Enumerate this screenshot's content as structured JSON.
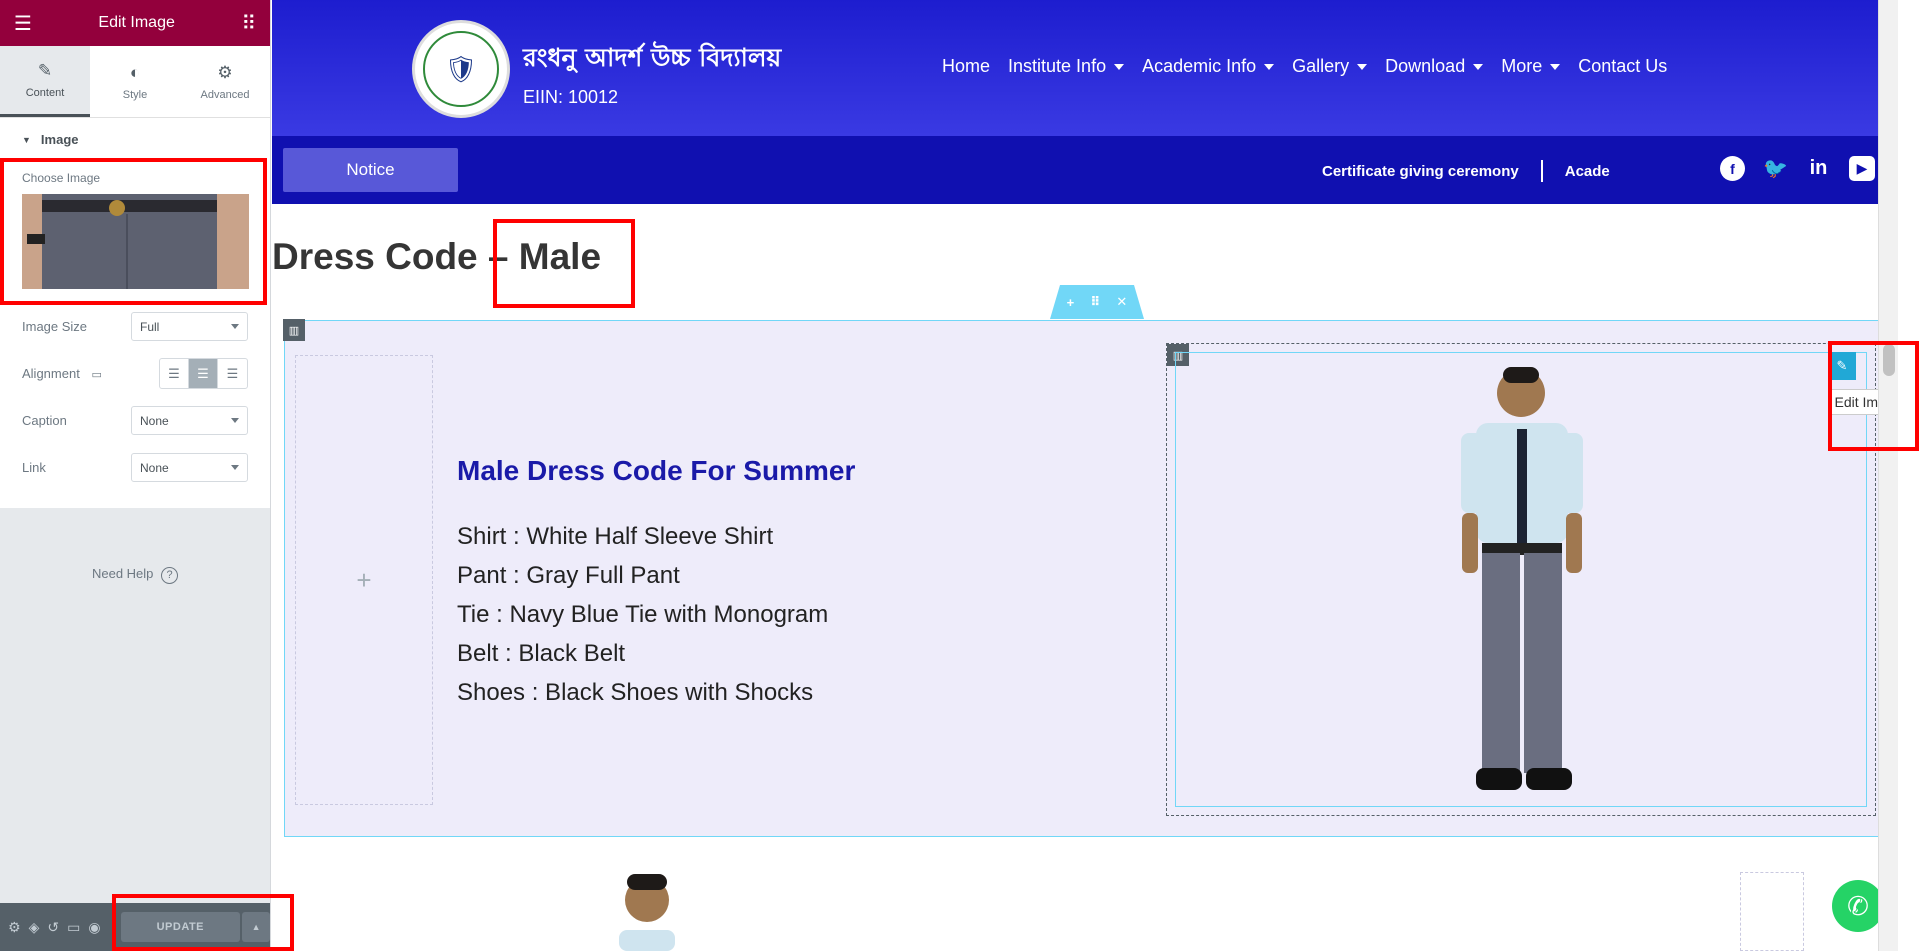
{
  "panel": {
    "title": "Edit Image",
    "tabs": [
      {
        "label": "Content",
        "icon": "pencil-icon"
      },
      {
        "label": "Style",
        "icon": "contrast-icon"
      },
      {
        "label": "Advanced",
        "icon": "gear-icon"
      }
    ],
    "section_title": "Image",
    "choose_image_label": "Choose Image",
    "image_size_label": "Image Size",
    "image_size_value": "Full",
    "alignment_label": "Alignment",
    "caption_label": "Caption",
    "caption_value": "None",
    "link_label": "Link",
    "link_value": "None",
    "need_help": "Need Help",
    "update_label": "UPDATE"
  },
  "site": {
    "school_name": "রংধনু আদর্শ উচ্চ বিদ্যালয়",
    "eiin": "EIIN: 10012",
    "nav": [
      {
        "label": "Home",
        "dropdown": false
      },
      {
        "label": "Institute Info",
        "dropdown": true
      },
      {
        "label": "Academic Info",
        "dropdown": true
      },
      {
        "label": "Gallery",
        "dropdown": true
      },
      {
        "label": "Download",
        "dropdown": true
      },
      {
        "label": "More",
        "dropdown": true
      },
      {
        "label": "Contact Us",
        "dropdown": false
      }
    ],
    "notice_label": "Notice",
    "ticker_1": "Certificate giving ceremony",
    "ticker_2": "Acade",
    "page_title": "Dress Code – Male",
    "dress_heading": "Male Dress Code For Summer",
    "dress_items": [
      "Shirt : White Half Sleeve Shirt",
      "Pant : Gray Full Pant",
      "Tie : Navy Blue Tie with Monogram",
      "Belt : Black Belt",
      "Shoes : Black Shoes with Shocks"
    ],
    "edit_tooltip": "Edit Image"
  },
  "colors": {
    "panel_header": "#93003c",
    "header_blue": "#2a2ad8",
    "bar_blue": "#1010b0",
    "heading_blue": "#1a1aa8",
    "selection_cyan": "#71d7f7",
    "highlight_red": "#ff0000"
  }
}
